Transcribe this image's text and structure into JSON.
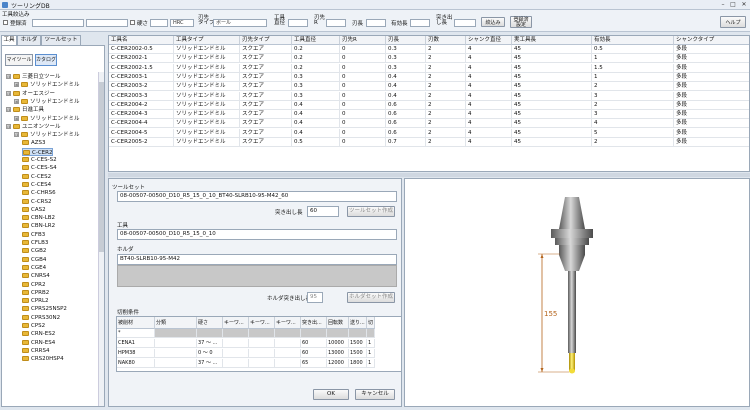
{
  "window": {
    "title": "ツーリングDB",
    "min": "–",
    "max": "□",
    "close": "✕"
  },
  "filter": {
    "label": "工具絞込み",
    "reg_label": "登録済",
    "reg_value": "",
    "box2": "",
    "hardness_label": "硬さ",
    "hardness_value": "",
    "hrc": "HRC",
    "tip_label": "刃先\nタイプ",
    "tip_value": "ボール",
    "dia_label": "工具\n直径",
    "dia_value": "",
    "r_label": "刃先\nR",
    "r_value": "",
    "blade_label": "刃長",
    "blade_value": "",
    "len_label": "有効長",
    "len_value": "",
    "overhang_label": "突き出\nし長",
    "overhang_value": "",
    "btn_filter": "絞込み",
    "btn_reg": "登録済\n設定",
    "btn_help": "ヘルプ"
  },
  "left": {
    "tabs": [
      "工具",
      "ホルダ",
      "ツールセット"
    ],
    "btn_my": "マイツール",
    "btn_catalog": "カタログ",
    "tree": [
      {
        "level": 0,
        "exp": "⊟",
        "label": "三菱日立ツール"
      },
      {
        "level": 1,
        "exp": "⊞",
        "label": "ソリッドエンドミル"
      },
      {
        "level": 0,
        "exp": "⊟",
        "label": "オーエスジー"
      },
      {
        "level": 1,
        "exp": "⊞",
        "label": "ソリッドエンドミル"
      },
      {
        "level": 0,
        "exp": "⊟",
        "label": "日進工具"
      },
      {
        "level": 1,
        "exp": "⊞",
        "label": "ソリッドエンドミル"
      },
      {
        "level": 0,
        "exp": "⊟",
        "label": "ユニオンツール"
      },
      {
        "level": 1,
        "exp": "⊟",
        "label": "ソリッドエンドミル"
      },
      {
        "level": 2,
        "exp": "",
        "label": "AZS3"
      },
      {
        "level": 2,
        "exp": "",
        "label": "C-CER2",
        "sel": true
      },
      {
        "level": 2,
        "exp": "",
        "label": "C-CES-S2"
      },
      {
        "level": 2,
        "exp": "",
        "label": "C-CES-S4"
      },
      {
        "level": 2,
        "exp": "",
        "label": "C-CES2"
      },
      {
        "level": 2,
        "exp": "",
        "label": "C-CES4"
      },
      {
        "level": 2,
        "exp": "",
        "label": "C-CHRS6"
      },
      {
        "level": 2,
        "exp": "",
        "label": "C-CRS2"
      },
      {
        "level": 2,
        "exp": "",
        "label": "CAS2"
      },
      {
        "level": 2,
        "exp": "",
        "label": "CBN-LB2"
      },
      {
        "level": 2,
        "exp": "",
        "label": "CBN-LR2"
      },
      {
        "level": 2,
        "exp": "",
        "label": "CFB3"
      },
      {
        "level": 2,
        "exp": "",
        "label": "CFLB3"
      },
      {
        "level": 2,
        "exp": "",
        "label": "CGB2"
      },
      {
        "level": 2,
        "exp": "",
        "label": "CGB4"
      },
      {
        "level": 2,
        "exp": "",
        "label": "CGE4"
      },
      {
        "level": 2,
        "exp": "",
        "label": "CNRS4"
      },
      {
        "level": 2,
        "exp": "",
        "label": "CPR2"
      },
      {
        "level": 2,
        "exp": "",
        "label": "CPRB2"
      },
      {
        "level": 2,
        "exp": "",
        "label": "CPRL2"
      },
      {
        "level": 2,
        "exp": "",
        "label": "CPRS25NSP2"
      },
      {
        "level": 2,
        "exp": "",
        "label": "CPRS30N2"
      },
      {
        "level": 2,
        "exp": "",
        "label": "CPS2"
      },
      {
        "level": 2,
        "exp": "",
        "label": "CRN-ES2"
      },
      {
        "level": 2,
        "exp": "",
        "label": "CRN-ES4"
      },
      {
        "level": 2,
        "exp": "",
        "label": "CRRS4"
      },
      {
        "level": 2,
        "exp": "",
        "label": "CRS20HSP4"
      }
    ]
  },
  "grid": {
    "headers": [
      "工具名",
      "工具タイプ",
      "刃先タイプ",
      "工具直径",
      "刃先R",
      "刃長",
      "刃数",
      "シャンク直径",
      "実工具長",
      "有効長",
      "シャンクタイプ"
    ],
    "rows": [
      [
        "C-CER2002-0.5",
        "ソリッドエンドミル",
        "スクエア",
        "0.2",
        "0",
        "0.3",
        "2",
        "4",
        "45",
        "0.5",
        "多段"
      ],
      [
        "C-CER2002-1",
        "ソリッドエンドミル",
        "スクエア",
        "0.2",
        "0",
        "0.3",
        "2",
        "4",
        "45",
        "1",
        "多段"
      ],
      [
        "C-CER2002-1.5",
        "ソリッドエンドミル",
        "スクエア",
        "0.2",
        "0",
        "0.3",
        "2",
        "4",
        "45",
        "1.5",
        "多段"
      ],
      [
        "C-CER2003-1",
        "ソリッドエンドミル",
        "スクエア",
        "0.3",
        "0",
        "0.4",
        "2",
        "4",
        "45",
        "1",
        "多段"
      ],
      [
        "C-CER2003-2",
        "ソリッドエンドミル",
        "スクエア",
        "0.3",
        "0",
        "0.4",
        "2",
        "4",
        "45",
        "2",
        "多段"
      ],
      [
        "C-CER2003-3",
        "ソリッドエンドミル",
        "スクエア",
        "0.3",
        "0",
        "0.4",
        "2",
        "4",
        "45",
        "3",
        "多段"
      ],
      [
        "C-CER2004-2",
        "ソリッドエンドミル",
        "スクエア",
        "0.4",
        "0",
        "0.6",
        "2",
        "4",
        "45",
        "2",
        "多段"
      ],
      [
        "C-CER2004-3",
        "ソリッドエンドミル",
        "スクエア",
        "0.4",
        "0",
        "0.6",
        "2",
        "4",
        "45",
        "3",
        "多段"
      ],
      [
        "C-CER2004-4",
        "ソリッドエンドミル",
        "スクエア",
        "0.4",
        "0",
        "0.6",
        "2",
        "4",
        "45",
        "4",
        "多段"
      ],
      [
        "C-CER2004-5",
        "ソリッドエンドミル",
        "スクエア",
        "0.4",
        "0",
        "0.6",
        "2",
        "4",
        "45",
        "5",
        "多段"
      ],
      [
        "C-CER2005-2",
        "ソリッドエンドミル",
        "スクエア",
        "0.5",
        "0",
        "0.7",
        "2",
        "4",
        "45",
        "2",
        "多段"
      ]
    ]
  },
  "form": {
    "toolset_label": "ツールセット",
    "toolset_value": "08-00507-00500_D10_R5_15_0_10_BT40-SLRB10-95-M42_60",
    "overhang_label": "突き出し長",
    "overhang_value": "60",
    "btn_create_toolset": "ツールセット作成",
    "tool_label": "工具",
    "tool_value": "08-00507-00500_D10_R5_15_0_10",
    "holder_label": "ホルダ",
    "holder_value": "BT40-SLRB10-95-M42",
    "holder_overhang_label": "ホルダ突き出し長",
    "holder_overhang_value": "95",
    "btn_create_holder": "ホルダセット作成",
    "cut_label": "切削条件",
    "cut_headers": [
      "被削材",
      "分類",
      "硬さ",
      "キーワ...",
      "キーワ...",
      "キーワ...",
      "突き出...",
      "回転数",
      "送り...",
      "切"
    ],
    "cut_rows": [
      [
        "*",
        "",
        "",
        "",
        "",
        "",
        "",
        "",
        "",
        ""
      ],
      [
        "CENA1",
        "",
        "37 ～ ...",
        "",
        "",
        "",
        "60",
        "10000",
        "1500",
        "1"
      ],
      [
        "HPM38",
        "",
        "0 ～ 0",
        "",
        "",
        "",
        "60",
        "13000",
        "1500",
        "1"
      ],
      [
        "NAK80",
        "",
        "37 ～ ...",
        "",
        "",
        "",
        "65",
        "12000",
        "1800",
        "1"
      ]
    ],
    "btn_ok": "OK",
    "btn_cancel": "キャンセル"
  },
  "preview": {
    "dimension": "155"
  }
}
